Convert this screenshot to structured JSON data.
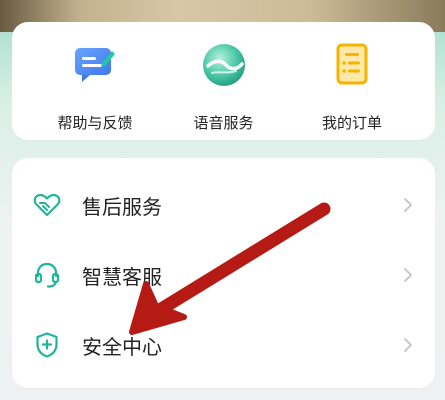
{
  "quick_actions": [
    {
      "label": "帮助与反馈",
      "icon": "feedback-icon"
    },
    {
      "label": "语音服务",
      "icon": "voice-service-icon"
    },
    {
      "label": "我的订单",
      "icon": "order-icon"
    }
  ],
  "service_list": [
    {
      "label": "售后服务",
      "icon": "handshake-heart-icon"
    },
    {
      "label": "智慧客服",
      "icon": "headset-icon"
    },
    {
      "label": "安全中心",
      "icon": "shield-plus-icon"
    }
  ],
  "colors": {
    "accent_green": "#21b59a",
    "feedback_blue": "#4d8cf5",
    "order_yellow": "#f4b400",
    "annotation_red": "#b51a14"
  }
}
